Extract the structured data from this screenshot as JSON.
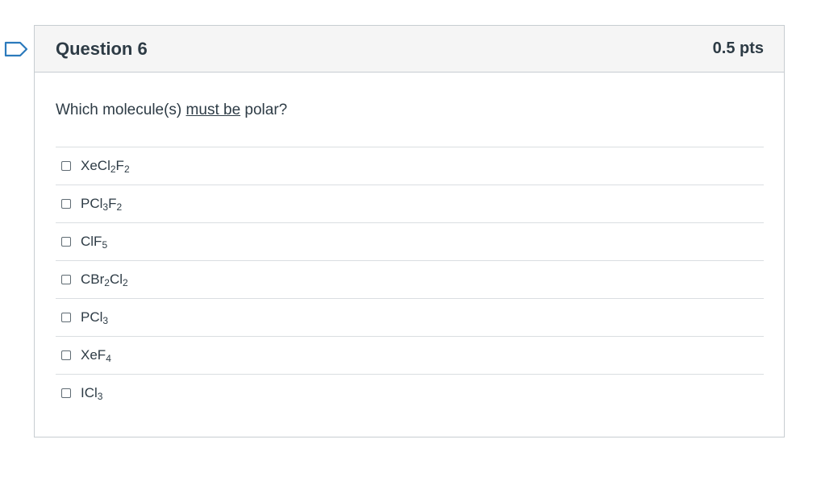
{
  "question": {
    "title": "Question 6",
    "points": "0.5 pts",
    "prompt_before": "Which molecule(s) ",
    "prompt_emphasis": "must be",
    "prompt_after": " polar?"
  },
  "answers": [
    {
      "parts": [
        [
          "XeCl",
          ""
        ],
        [
          "2",
          "sub"
        ],
        [
          "F",
          ""
        ],
        [
          "2",
          "sub"
        ]
      ]
    },
    {
      "parts": [
        [
          "PCl",
          ""
        ],
        [
          "3",
          "sub"
        ],
        [
          "F",
          ""
        ],
        [
          "2",
          "sub"
        ]
      ]
    },
    {
      "parts": [
        [
          "ClF",
          ""
        ],
        [
          "5",
          "sub"
        ]
      ]
    },
    {
      "parts": [
        [
          "CBr",
          ""
        ],
        [
          "2",
          "sub"
        ],
        [
          "Cl",
          ""
        ],
        [
          "2",
          "sub"
        ]
      ]
    },
    {
      "parts": [
        [
          "PCl",
          ""
        ],
        [
          "3",
          "sub"
        ]
      ]
    },
    {
      "parts": [
        [
          "XeF",
          ""
        ],
        [
          "4",
          "sub"
        ]
      ]
    },
    {
      "parts": [
        [
          "ICl",
          ""
        ],
        [
          "3",
          "sub"
        ]
      ]
    }
  ],
  "colors": {
    "flag": "#2b7abc",
    "header_bg": "#f5f5f5",
    "border": "#c7cdd1",
    "text": "#2d3b45"
  },
  "icons": {
    "flag": "bookmark-flag-icon",
    "checkbox": "checkbox-icon"
  }
}
